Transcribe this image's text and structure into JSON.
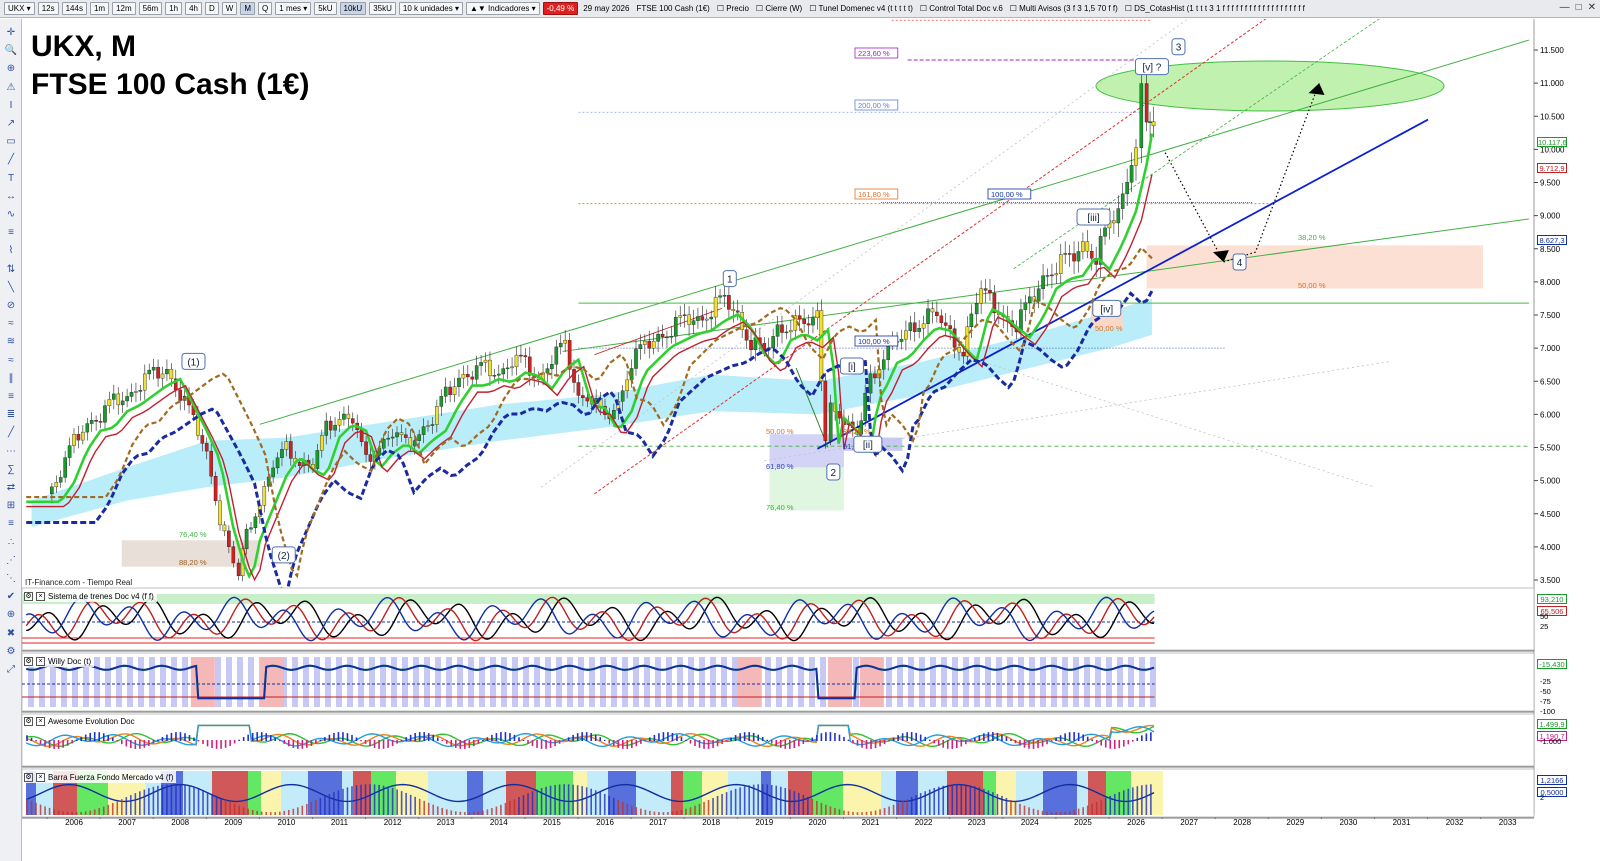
{
  "toolbar": {
    "symbol": "UKX",
    "intervals": [
      "12s",
      "144s",
      "1m",
      "12m",
      "56m",
      "1h",
      "4h",
      "D",
      "W",
      "M",
      "Q"
    ],
    "active_interval": "M",
    "range": "1 mes",
    "units": [
      "5kU",
      "10kU",
      "35kU"
    ],
    "active_unit": "10kU",
    "units_dropdown": "10 k unidades",
    "indicators_label": "Indicadores",
    "change": "-0,49 %",
    "date": "29 may 2026",
    "instrument": "FTSE 100 Cash (1€)",
    "overlays": [
      "Precio",
      "Cierre (W)",
      "Tunel Domenec v4 (t t t t t)",
      "Control Total Doc v.6",
      "Multi Avisos (3 f 3 1,5 70 f f)",
      "DS_CotasHist (1 t t t 3 1 f f f f f f f f f f f f f f f f f f f"
    ]
  },
  "title": {
    "line1": "UKX, M",
    "line2": "FTSE 100 Cash (1€)"
  },
  "source": "IT-Finance.com - Tiempo Real",
  "panels": [
    {
      "title": "Sistema de trenes Doc v4 (f f)",
      "values": [
        "93,210",
        "65,506"
      ],
      "ticks": [
        "50",
        "25"
      ]
    },
    {
      "title": "Willy Doc (t)",
      "values": [
        "-15,430"
      ],
      "ticks": [
        "-25",
        "-50",
        "-75",
        "-100"
      ]
    },
    {
      "title": "Awesome Evolution Doc",
      "values": [
        "1.499,9",
        "1.190,7"
      ],
      "ticks": [
        "-1.000"
      ]
    },
    {
      "title": "Barra Fuerza Fondo Mercado v4 (f)",
      "values": [
        "1,2166",
        "0,5000"
      ],
      "ticks": [
        "2"
      ]
    }
  ],
  "chart_data": {
    "type": "candlestick",
    "title": "UKX, M — FTSE 100 Cash (1€)",
    "x_ticks": [
      "2006",
      "2007",
      "2008",
      "2009",
      "2010",
      "2011",
      "2012",
      "2013",
      "2014",
      "2015",
      "2016",
      "2017",
      "2018",
      "2019",
      "2020",
      "2021",
      "2022",
      "2023",
      "2024",
      "2025",
      "2026",
      "2027",
      "2028",
      "2029",
      "2030",
      "2031",
      "2032",
      "2033"
    ],
    "y_ticks": [
      "11.500",
      "11.000",
      "10.500",
      "10.000",
      "9.500",
      "9.000",
      "8.500",
      "8.000",
      "7.500",
      "7.000",
      "6.500",
      "6.000",
      "5.500",
      "5.000",
      "4.500",
      "4.000",
      "3.500"
    ],
    "ylim": [
      3300,
      11800
    ],
    "xlim": [
      2005.0,
      2033.5
    ],
    "price_labels": [
      {
        "value": 10117,
        "label": "10.117,6",
        "color": "#1a9a2a"
      },
      {
        "value": 9712,
        "label": "9.712,9",
        "color": "#c02020"
      },
      {
        "value": 8627,
        "label": "8.627,3",
        "color": "#1030a0"
      }
    ],
    "close_series": [
      [
        2005.5,
        4800
      ],
      [
        2005.75,
        5100
      ],
      [
        2006.0,
        5600
      ],
      [
        2006.25,
        5900
      ],
      [
        2006.5,
        5950
      ],
      [
        2006.75,
        6200
      ],
      [
        2007.0,
        6300
      ],
      [
        2007.25,
        6450
      ],
      [
        2007.5,
        6600
      ],
      [
        2007.75,
        6700
      ],
      [
        2008.0,
        6300
      ],
      [
        2008.25,
        5900
      ],
      [
        2008.5,
        5450
      ],
      [
        2008.75,
        4400
      ],
      [
        2009.0,
        3700
      ],
      [
        2009.1,
        3600
      ],
      [
        2009.25,
        4200
      ],
      [
        2009.5,
        4700
      ],
      [
        2009.75,
        5200
      ],
      [
        2010.0,
        5500
      ],
      [
        2010.25,
        5300
      ],
      [
        2010.5,
        5200
      ],
      [
        2010.75,
        5800
      ],
      [
        2011.0,
        6000
      ],
      [
        2011.25,
        5900
      ],
      [
        2011.5,
        5300
      ],
      [
        2011.75,
        5550
      ],
      [
        2012.0,
        5700
      ],
      [
        2012.25,
        5550
      ],
      [
        2012.5,
        5750
      ],
      [
        2012.75,
        5900
      ],
      [
        2013.0,
        6300
      ],
      [
        2013.25,
        6600
      ],
      [
        2013.5,
        6600
      ],
      [
        2013.75,
        6700
      ],
      [
        2014.0,
        6650
      ],
      [
        2014.25,
        6800
      ],
      [
        2014.5,
        6750
      ],
      [
        2014.75,
        6550
      ],
      [
        2015.0,
        6850
      ],
      [
        2015.25,
        7000
      ],
      [
        2015.5,
        6300
      ],
      [
        2015.75,
        6250
      ],
      [
        2016.0,
        5900
      ],
      [
        2016.25,
        6200
      ],
      [
        2016.5,
        6800
      ],
      [
        2016.75,
        7000
      ],
      [
        2017.0,
        7200
      ],
      [
        2017.25,
        7300
      ],
      [
        2017.5,
        7400
      ],
      [
        2017.75,
        7450
      ],
      [
        2018.0,
        7600
      ],
      [
        2018.25,
        7700
      ],
      [
        2018.5,
        7500
      ],
      [
        2018.75,
        7100
      ],
      [
        2019.0,
        6900
      ],
      [
        2019.25,
        7300
      ],
      [
        2019.5,
        7400
      ],
      [
        2019.75,
        7300
      ],
      [
        2020.0,
        7500
      ],
      [
        2020.15,
        5700
      ],
      [
        2020.25,
        6100
      ],
      [
        2020.5,
        5900
      ],
      [
        2020.75,
        5600
      ],
      [
        2020.9,
        6400
      ],
      [
        2021.0,
        6500
      ],
      [
        2021.25,
        6950
      ],
      [
        2021.5,
        7050
      ],
      [
        2021.75,
        7300
      ],
      [
        2022.0,
        7500
      ],
      [
        2022.25,
        7450
      ],
      [
        2022.5,
        7200
      ],
      [
        2022.75,
        7000
      ],
      [
        2022.9,
        7450
      ],
      [
        2023.0,
        7800
      ],
      [
        2023.25,
        7700
      ],
      [
        2023.5,
        7500
      ],
      [
        2023.75,
        7350
      ],
      [
        2024.0,
        7650
      ],
      [
        2024.25,
        8100
      ],
      [
        2024.5,
        8250
      ],
      [
        2024.75,
        8300
      ],
      [
        2025.0,
        8600
      ],
      [
        2025.25,
        8400
      ],
      [
        2025.5,
        8800
      ],
      [
        2025.75,
        9300
      ],
      [
        2026.0,
        10200
      ],
      [
        2026.1,
        10800
      ],
      [
        2026.2,
        10550
      ],
      [
        2026.33,
        10300
      ]
    ],
    "fibonacci_levels": [
      {
        "label": "223,60 %",
        "value": 11350,
        "color": "#a020c0"
      },
      {
        "label": "200,00 %",
        "value": 10560,
        "color": "#6080e0"
      },
      {
        "label": "161,80 %",
        "value": 9180,
        "color": "#e07020"
      },
      {
        "label": "100,00 %",
        "value": 9200,
        "color": "#1030a0"
      },
      {
        "label": "100,00 %",
        "value": 7000,
        "color": "#1030a0"
      },
      {
        "label": "76,40 %",
        "value": 4100,
        "color": "#40b040"
      },
      {
        "label": "88,20 %",
        "value": 3700,
        "color": "#a06020"
      },
      {
        "label": "50,00 %",
        "value": 5700,
        "color": "#e07020"
      },
      {
        "label": "61,80 %",
        "value": 5200,
        "color": "#3040c0"
      },
      {
        "label": "76,40 %",
        "value": 4600,
        "color": "#40b040"
      },
      {
        "label": "38,20 %",
        "value": 8550,
        "color": "#40b040"
      },
      {
        "label": "50,00 %",
        "value": 7900,
        "color": "#e07020"
      },
      {
        "label": "50,00 %",
        "value": 7350,
        "color": "#e07020"
      },
      {
        "label": "38,20 %",
        "value": 7650,
        "color": "#40b040"
      },
      {
        "label": "38,20 %",
        "value": 5700,
        "color": "#e07020"
      },
      {
        "label": "61,80 %",
        "value": 5450,
        "color": "#3040c0"
      }
    ],
    "wave_labels": [
      {
        "label": "(1)",
        "x": 2008.25,
        "y": 6800
      },
      {
        "label": "(2)",
        "x": 2009.95,
        "y": 3880
      },
      {
        "label": "1",
        "x": 2018.35,
        "y": 8050
      },
      {
        "label": "2",
        "x": 2020.3,
        "y": 5130
      },
      {
        "label": "[i]",
        "x": 2020.65,
        "y": 6730
      },
      {
        "label": "[ii]",
        "x": 2020.95,
        "y": 5550
      },
      {
        "label": "[iii]",
        "x": 2025.2,
        "y": 8980
      },
      {
        "label": "[iv]",
        "x": 2025.45,
        "y": 7600
      },
      {
        "label": "[v] ?",
        "x": 2026.3,
        "y": 11250
      },
      {
        "label": "3",
        "x": 2026.8,
        "y": 11550
      },
      {
        "label": "4",
        "x": 2027.95,
        "y": 8300
      }
    ]
  }
}
